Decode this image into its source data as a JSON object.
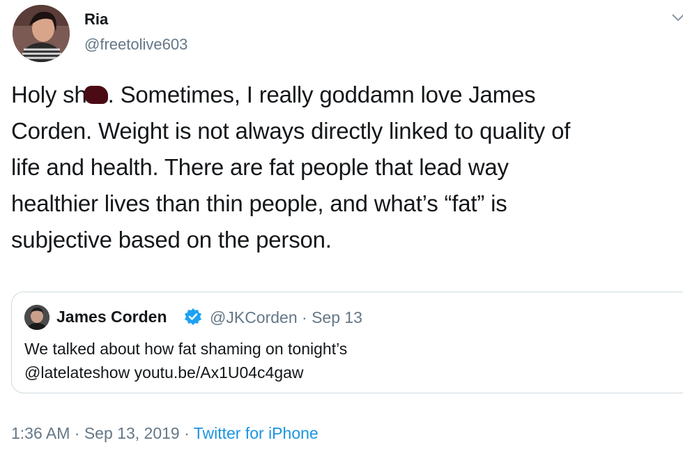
{
  "author": {
    "name": "Ria",
    "handle": "@freetolive603"
  },
  "tweet": {
    "lines": [
      [
        "Holy sh",
        "",
        ". Sometimes, I really goddamn love James"
      ],
      "Corden. Weight is not always directly linked to quality of",
      "life and health. There are fat people that lead way",
      "healthier lives than thin people, and what’s “fat” is",
      "subjective based on the person."
    ],
    "line1_before": "Holy sh",
    "line1_after": ". Sometimes, I really goddamn love James",
    "line2": "Corden. Weight is not always directly linked to quality of",
    "line3": "life and health. There are fat people that lead way",
    "line4": "healthier lives than thin people, and what’s “fat” is",
    "line5": "subjective based on the person."
  },
  "quoted_tweet": {
    "name": "James Corden",
    "handle_date": "@JKCorden · Sep 13",
    "line1": "We talked about how fat shaming on tonight’s",
    "line2": "@latelateshow youtu.be/Ax1U04c4gaw"
  },
  "meta": {
    "time": "1:36 AM",
    "sep1": " · ",
    "date": "Sep 13, 2019",
    "sep2": " · ",
    "source": "Twitter for iPhone"
  },
  "colors": {
    "verified": "#1da1f2",
    "link": "#1b95e0",
    "censor_mark": "#4b0b14"
  },
  "icons": {
    "verified": "verified-badge-icon",
    "menu": "chevron-down-icon"
  }
}
